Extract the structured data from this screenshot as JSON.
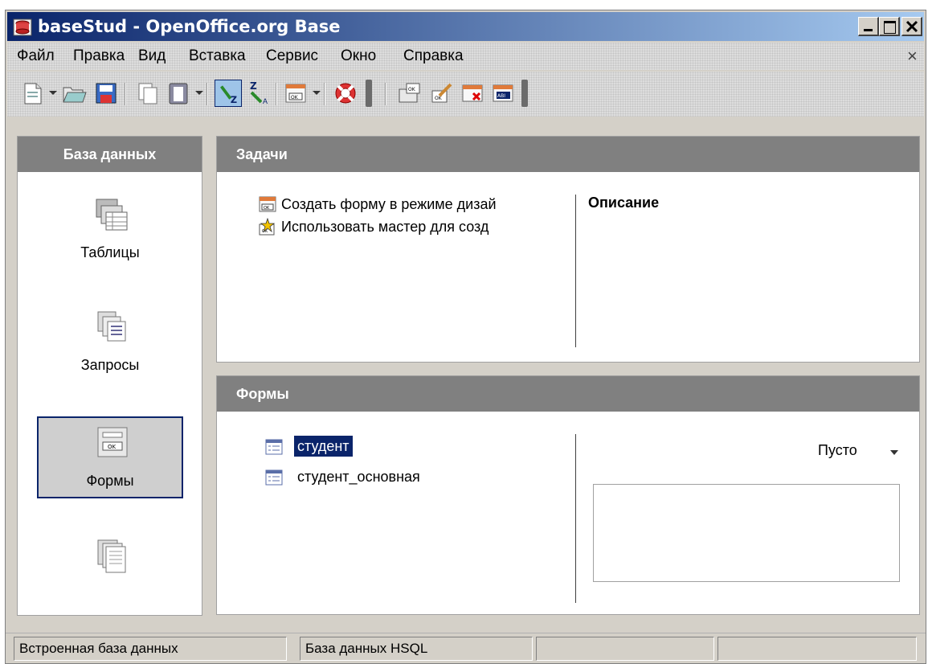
{
  "window": {
    "title": "baseStud - OpenOffice.org Base",
    "menu_close": "×"
  },
  "menu": [
    "Файл",
    "Правка",
    "Вид",
    "Вставка",
    "Сервис",
    "Окно",
    "Справка"
  ],
  "toolbar": {
    "icons": [
      "new-document-icon",
      "open-icon",
      "save-icon",
      "copy-icon",
      "paste-icon",
      "sort-ascending-icon",
      "sort-descending-icon",
      "form-icon",
      "help-icon",
      "open-form-icon",
      "edit-form-icon",
      "delete-form-icon",
      "rename-form-icon"
    ]
  },
  "left_panel": {
    "header": "База данных",
    "items": [
      {
        "label": "Таблицы",
        "icon": "tables-icon",
        "selected": false
      },
      {
        "label": "Запросы",
        "icon": "queries-icon",
        "selected": false
      },
      {
        "label": "Формы",
        "icon": "forms-icon",
        "selected": true
      },
      {
        "label": "",
        "icon": "reports-icon",
        "selected": false
      }
    ]
  },
  "tasks": {
    "header": "Задачи",
    "items": [
      {
        "label": "Создать форму в режиме дизай",
        "icon": "design-form-icon"
      },
      {
        "label": "Использовать мастер для созд",
        "icon": "wizard-icon"
      }
    ],
    "description_heading": "Описание"
  },
  "forms": {
    "header": "Формы",
    "items": [
      {
        "label": "студент",
        "selected": true
      },
      {
        "label": "студент_основная",
        "selected": false
      }
    ],
    "preview_mode": "Пусто"
  },
  "statusbar": {
    "cells": [
      "Встроенная база данных",
      "База данных HSQL",
      "",
      ""
    ]
  },
  "colors": {
    "titlebar_start": "#0a246a",
    "titlebar_end": "#a6caf0",
    "panel_header": "#808080",
    "selection": "#0a246a"
  }
}
